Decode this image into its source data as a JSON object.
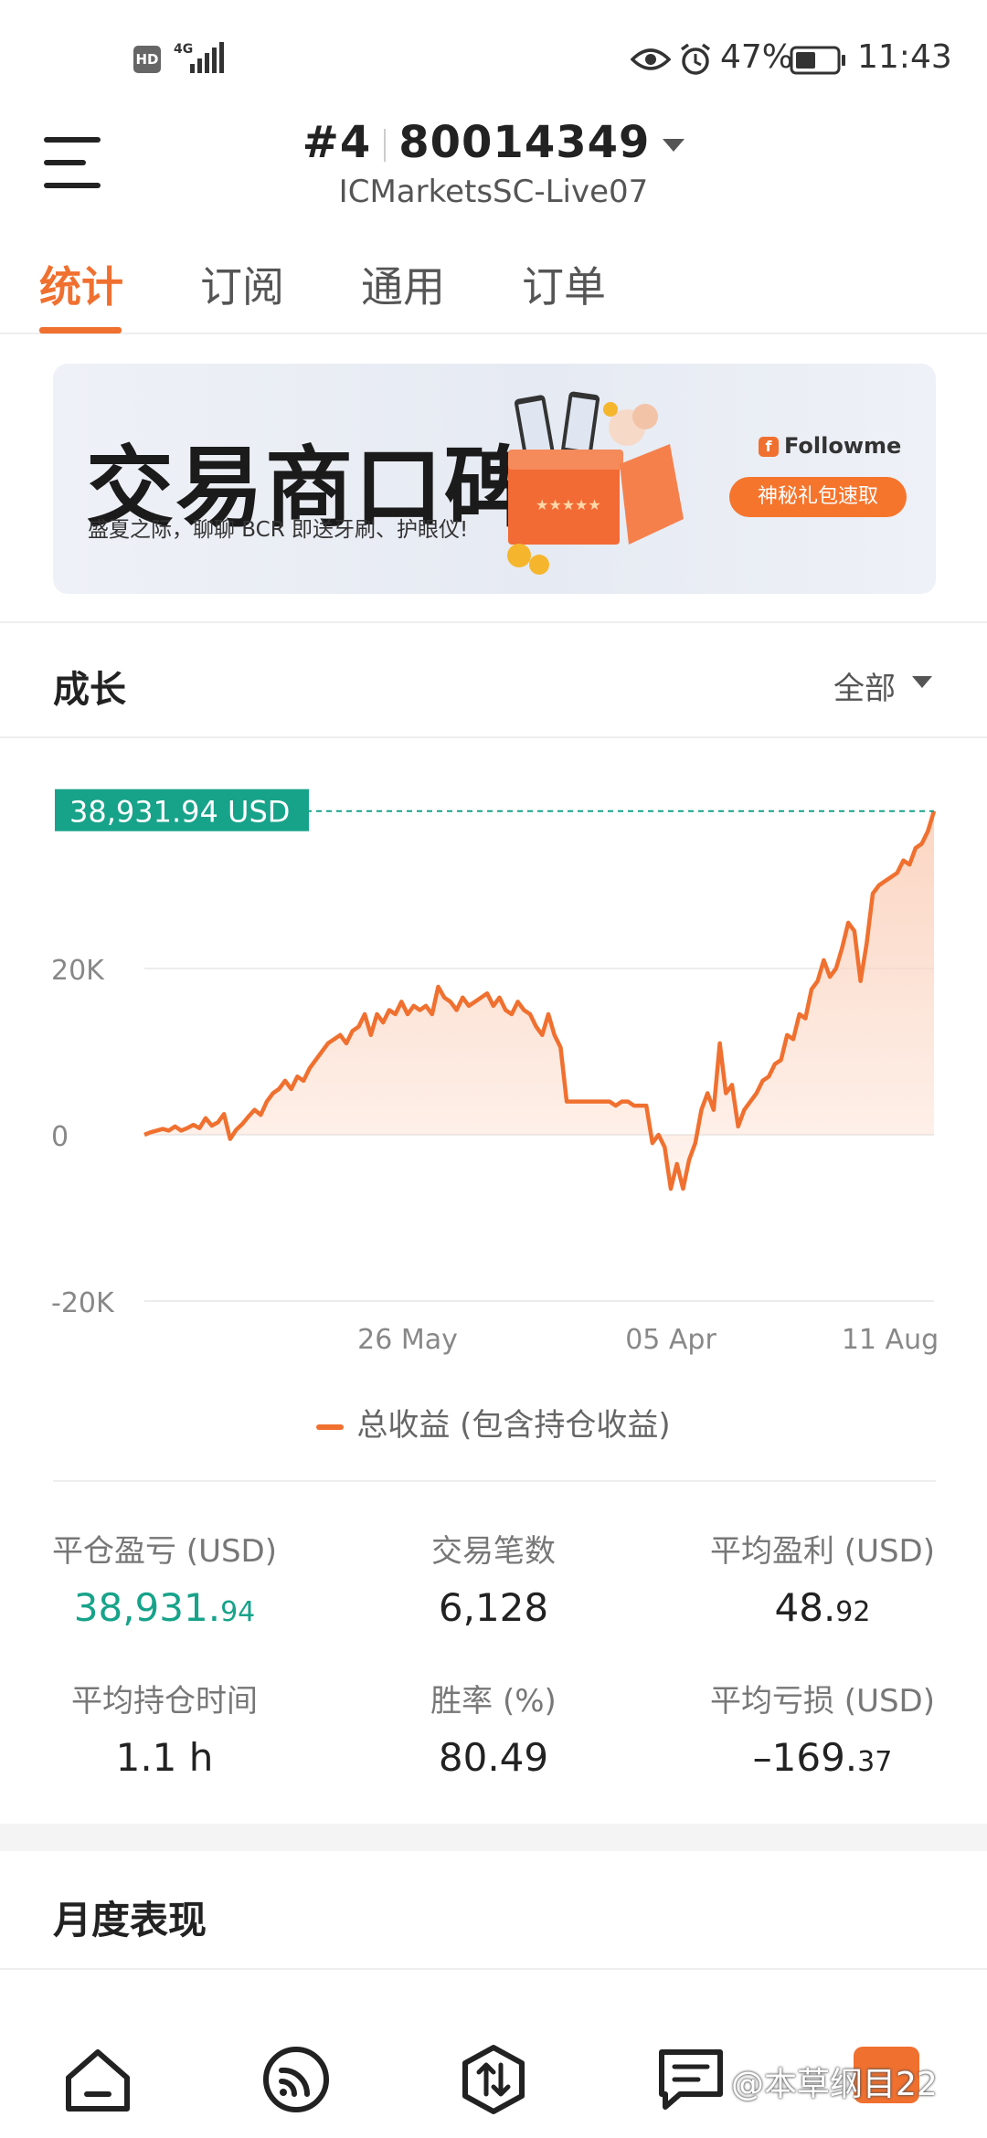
{
  "status_bar": {
    "hd_label": "HD",
    "network_label": "4G",
    "battery_percent": "47%",
    "time": "11:43",
    "icons": [
      "signal-icon",
      "eye-icon",
      "alarm-icon",
      "battery-icon"
    ]
  },
  "header": {
    "account_index": "#4",
    "account_number": "80014349",
    "server": "ICMarketsSC-Live07"
  },
  "tabs": [
    {
      "label": "统计",
      "active": true
    },
    {
      "label": "订阅",
      "active": false
    },
    {
      "label": "通用",
      "active": false
    },
    {
      "label": "订单",
      "active": false
    }
  ],
  "banner": {
    "title": "交易商口碑",
    "subtitle": "盛夏之际，聊聊 BCR 即送牙刷、护眼仪!",
    "brand": "Followme",
    "button_label": "神秘礼包速取"
  },
  "growth": {
    "title": "成长",
    "range_label": "全部"
  },
  "chart_data": {
    "type": "area",
    "title": "",
    "xlabel": "",
    "ylabel": "",
    "current_value_label": "38,931.94 USD",
    "y_ticks": [
      "20K",
      "0",
      "-20K"
    ],
    "x_ticks": [
      "26 May",
      "05 Apr",
      "11 Aug"
    ],
    "ylim": [
      -20000,
      40000
    ],
    "grid": true,
    "legend_position": "bottom",
    "colors": {
      "line": "#f0702f",
      "fill": "#fbd3bf",
      "reference": "#17a38a"
    },
    "series": [
      {
        "name": "总收益 (包含持仓收益)",
        "values": [
          0,
          300,
          500,
          700,
          500,
          1000,
          500,
          800,
          1200,
          800,
          2000,
          1100,
          1500,
          2500,
          -500,
          600,
          1300,
          2200,
          3000,
          2400,
          4000,
          5000,
          5500,
          6500,
          5500,
          7000,
          6500,
          8000,
          9000,
          10000,
          11000,
          11500,
          12000,
          11000,
          12500,
          13000,
          14500,
          12000,
          14500,
          13500,
          15000,
          14500,
          16000,
          14500,
          15500,
          15000,
          15500,
          14500,
          17800,
          16500,
          16000,
          15000,
          16500,
          15500,
          16000,
          16500,
          17000,
          15500,
          16500,
          15000,
          14500,
          16000,
          15000,
          14500,
          13000,
          12000,
          14500,
          12000,
          10500,
          4000,
          4000,
          4000,
          4000,
          4000,
          4000,
          4000,
          4000,
          3500,
          4000,
          4000,
          3500,
          3500,
          3500,
          -1000,
          0,
          -1500,
          -6500,
          -3500,
          -6500,
          -3000,
          -1000,
          3000,
          5000,
          3000,
          11000,
          5000,
          6000,
          1000,
          3000,
          4000,
          5000,
          6500,
          7000,
          8500,
          9000,
          12000,
          11500,
          14500,
          14000,
          17500,
          18500,
          21000,
          19000,
          20000,
          22500,
          25500,
          24500,
          18500,
          23000,
          29000,
          30000,
          30500,
          31000,
          31500,
          33000,
          32500,
          34500,
          35000,
          36500,
          38931.94
        ]
      }
    ]
  },
  "legend": {
    "label": "总收益 (包含持仓收益)"
  },
  "stats": [
    {
      "label": "平仓盈亏 (USD)",
      "value_main": "38,931.",
      "value_small": "94",
      "color": "#17a38a"
    },
    {
      "label": "交易笔数",
      "value_main": "6,128",
      "value_small": "",
      "color": "#222222"
    },
    {
      "label": "平均盈利 (USD)",
      "value_main": "48.",
      "value_small": "92",
      "color": "#222222"
    },
    {
      "label": "平均持仓时间",
      "value_main": "1.1 h",
      "value_small": "",
      "color": "#222222"
    },
    {
      "label": "胜率 (%)",
      "value_main": "80.49",
      "value_small": "",
      "color": "#222222"
    },
    {
      "label": "平均亏损 (USD)",
      "value_main": "–169.",
      "value_small": "37",
      "color": "#222222"
    }
  ],
  "monthly": {
    "title": "月度表现"
  },
  "bottom_nav": {
    "icons": [
      "home-icon",
      "feed-icon",
      "trade-icon",
      "messages-icon"
    ]
  },
  "watermark": "@本草纲目22",
  "accent_color": "#f0702f"
}
